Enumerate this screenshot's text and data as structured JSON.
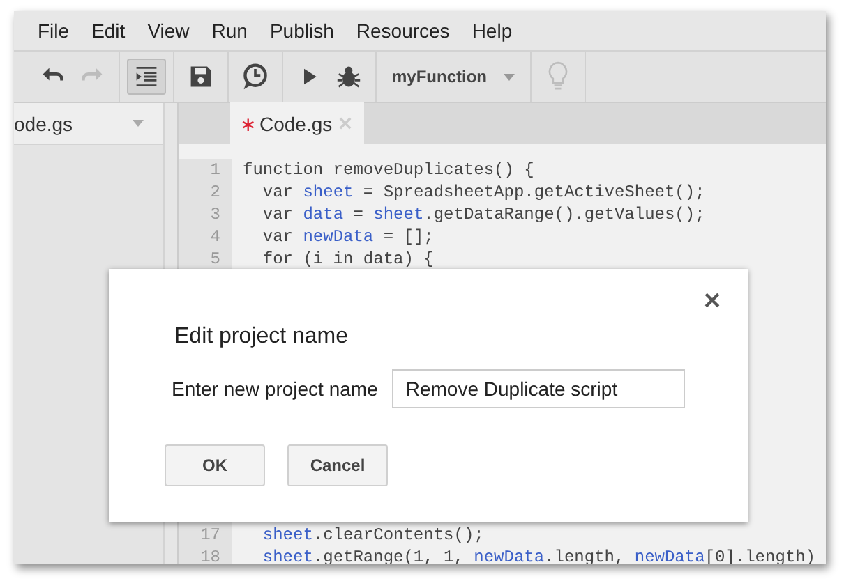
{
  "menu": [
    "File",
    "Edit",
    "View",
    "Run",
    "Publish",
    "Resources",
    "Help"
  ],
  "toolbar": {
    "buttons": [
      {
        "kind": "undo",
        "disabled": false,
        "on": false
      },
      {
        "kind": "redo",
        "disabled": true,
        "on": false
      },
      {
        "kind": "indent",
        "disabled": false,
        "on": true
      },
      {
        "kind": "save",
        "disabled": false,
        "on": false
      },
      {
        "kind": "triggers",
        "disabled": false,
        "on": false
      },
      {
        "kind": "run",
        "disabled": false,
        "on": false
      },
      {
        "kind": "debug",
        "disabled": false,
        "on": false
      }
    ],
    "function_select": "myFunction",
    "hint_disabled": true
  },
  "sidebar": {
    "file": "ode.gs"
  },
  "tabs": [
    {
      "label": "Code.gs",
      "modified_mark": "∗",
      "selected": true
    }
  ],
  "code": [
    {
      "number": "1",
      "parts": [
        {
          "text": "function removeDuplicates() {",
          "kind": "plain"
        }
      ]
    },
    {
      "number": "2",
      "parts": [
        {
          "text": "  var ",
          "kind": "plain"
        },
        {
          "text": "sheet",
          "kind": "var"
        },
        {
          "text": " = SpreadsheetApp.getActiveSheet();",
          "kind": "plain"
        }
      ]
    },
    {
      "number": "3",
      "parts": [
        {
          "text": "  var ",
          "kind": "plain"
        },
        {
          "text": "data",
          "kind": "var"
        },
        {
          "text": " = ",
          "kind": "plain"
        },
        {
          "text": "sheet",
          "kind": "var"
        },
        {
          "text": ".getDataRange().getValues();",
          "kind": "plain"
        }
      ]
    },
    {
      "number": "4",
      "parts": [
        {
          "text": "  var ",
          "kind": "plain"
        },
        {
          "text": "newData",
          "kind": "var"
        },
        {
          "text": " = [];",
          "kind": "plain"
        }
      ]
    },
    {
      "number": "5",
      "parts": [
        {
          "text": "  for (i in data) {",
          "kind": "plain"
        }
      ]
    },
    {
      "number": "17",
      "parts": [
        {
          "text": "  sheet",
          "kind": "var"
        },
        {
          "text": ".clearContents();",
          "kind": "plain"
        }
      ]
    },
    {
      "number": "18",
      "parts": [
        {
          "text": "  sheet",
          "kind": "var"
        },
        {
          "text": ".getRange(1, 1, ",
          "kind": "plain"
        },
        {
          "text": "newData",
          "kind": "var"
        },
        {
          "text": ".length, ",
          "kind": "plain"
        },
        {
          "text": "newData",
          "kind": "var"
        },
        {
          "text": "[0].length)",
          "kind": "plain"
        }
      ]
    }
  ],
  "dialog": {
    "title": "Edit project name",
    "label": "Enter new project name",
    "value": "Remove Duplicate script",
    "buttons": [
      "OK",
      "Cancel"
    ]
  }
}
